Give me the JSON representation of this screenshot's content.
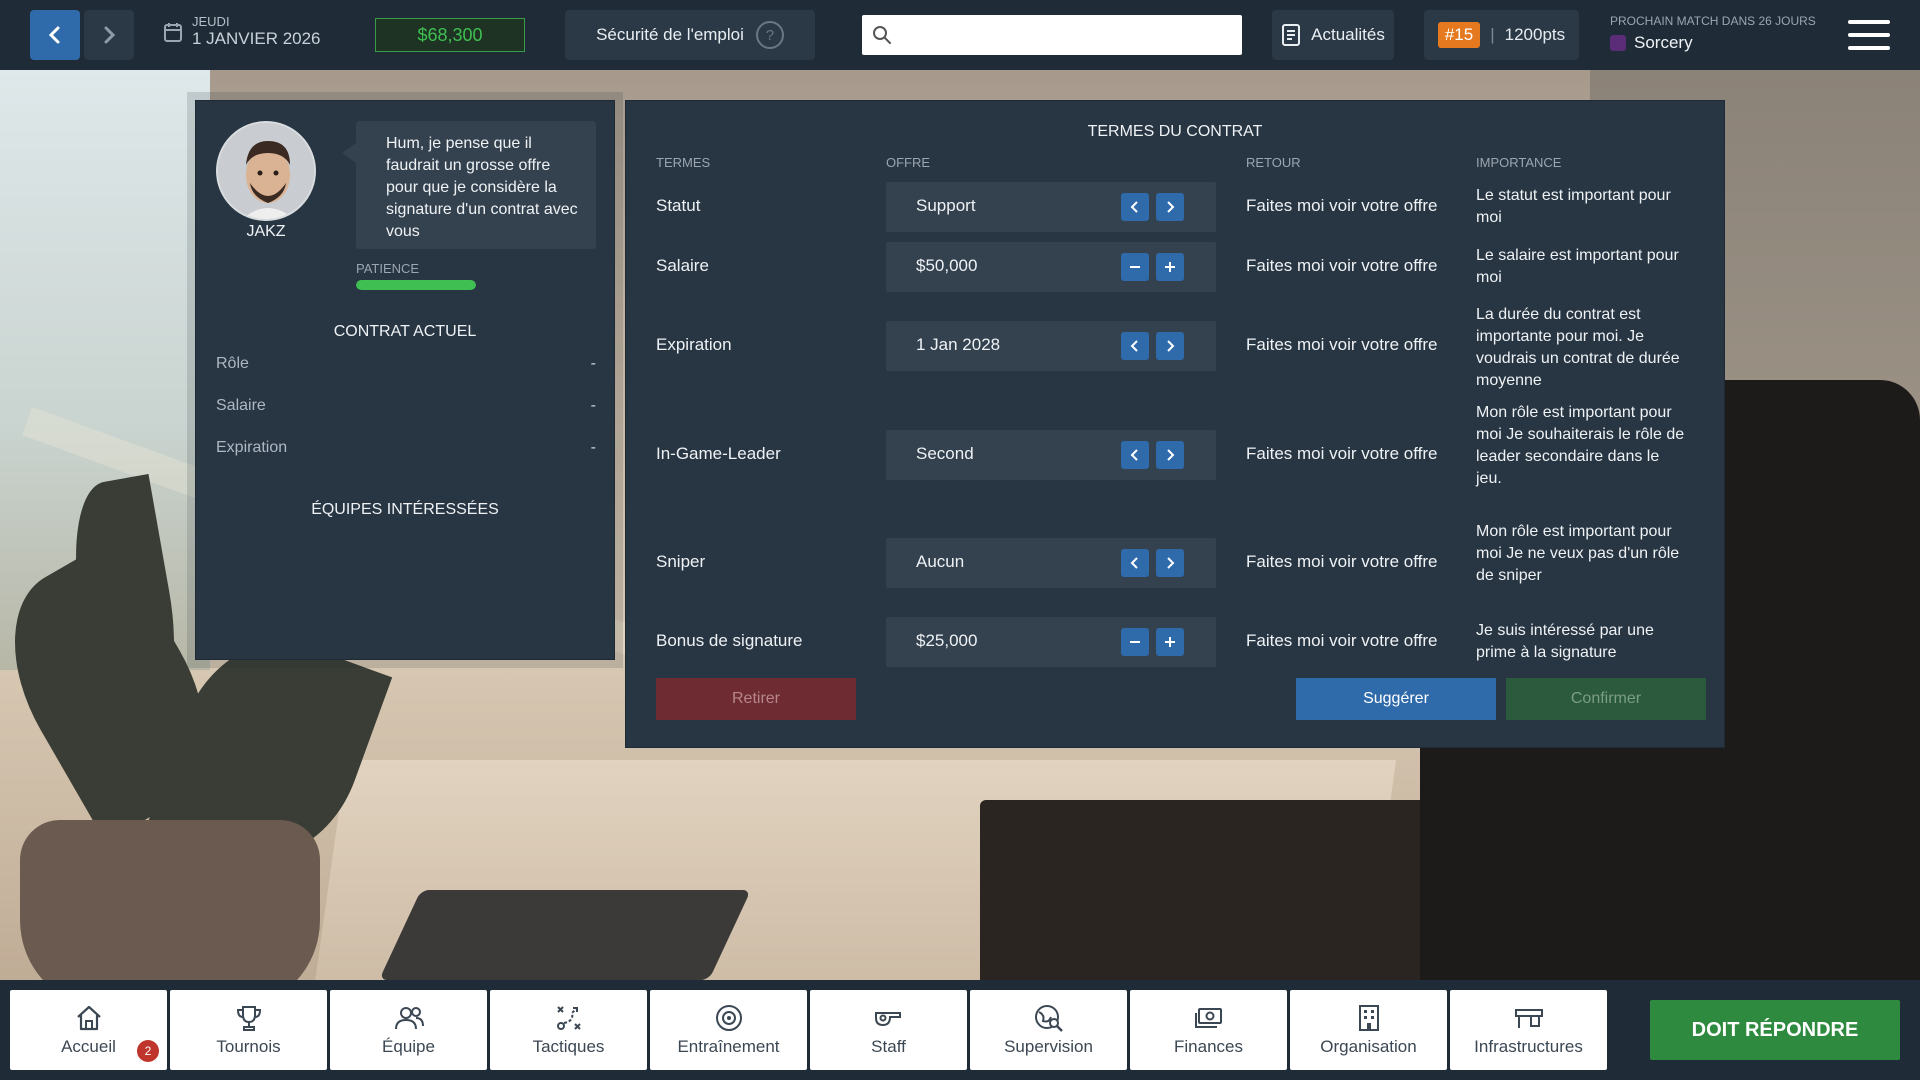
{
  "topbar": {
    "day": "JEUDI",
    "date": "1 JANVIER 2026",
    "money": "$68,300",
    "security_label": "Sécurité de l'emploi",
    "security_help": "?",
    "search_placeholder": "",
    "news_label": "Actualités",
    "rank_badge": "#15",
    "rank_sep": "|",
    "rank_points": "1200pts",
    "next_match_label": "PROCHAIN MATCH DANS 26 JOURS",
    "next_match_team": "Sorcery"
  },
  "player": {
    "name": "JAKZ",
    "speech": "Hum, je pense que il faudrait un grosse offre pour que je considère la signature d'un contrat avec vous",
    "patience_label": "PATIENCE",
    "patience_level": 1.0
  },
  "current_contract": {
    "title": "CONTRAT ACTUEL",
    "rows": [
      {
        "label": "Rôle",
        "value": "-"
      },
      {
        "label": "Salaire",
        "value": "-"
      },
      {
        "label": "Expiration",
        "value": "-"
      }
    ],
    "interested_title": "ÉQUIPES INTÉRESSÉES"
  },
  "contract_terms": {
    "title": "TERMES DU CONTRAT",
    "headers": {
      "terms": "TERMES",
      "offer": "OFFRE",
      "return": "RETOUR",
      "importance": "IMPORTANCE"
    },
    "rows": [
      {
        "term": "Statut",
        "offer": "Support",
        "control": "arrows",
        "return": "Faites moi voir votre offre",
        "importance": "Le statut est important pour moi"
      },
      {
        "term": "Salaire",
        "offer": "$50,000",
        "control": "plusminus",
        "return": "Faites moi voir votre offre",
        "importance": "Le salaire est important pour moi"
      },
      {
        "term": "Expiration",
        "offer": "1 Jan 2028",
        "control": "arrows",
        "return": "Faites moi voir votre offre",
        "importance": "La durée du contrat est importante pour moi. Je voudrais un contrat de durée moyenne"
      },
      {
        "term": "In-Game-Leader",
        "offer": "Second",
        "control": "arrows",
        "return": "Faites moi voir votre offre",
        "importance": "Mon rôle est important pour moi Je souhaiterais le rôle de leader secondaire dans le jeu."
      },
      {
        "term": "Sniper",
        "offer": "Aucun",
        "control": "arrows",
        "return": "Faites moi voir votre offre",
        "importance": "Mon rôle est important pour moi Je ne veux pas d'un rôle de sniper"
      },
      {
        "term": "Bonus de signature",
        "offer": "$25,000",
        "control": "plusminus",
        "return": "Faites moi voir votre offre",
        "importance": "Je suis intéressé par une prime à la signature"
      }
    ],
    "buttons": {
      "withdraw": "Retirer",
      "suggest": "Suggérer",
      "confirm": "Confirmer"
    }
  },
  "bottom_nav": {
    "tabs": [
      {
        "label": "Accueil",
        "icon": "home-icon"
      },
      {
        "label": "Tournois",
        "icon": "trophy-icon"
      },
      {
        "label": "Équipe",
        "icon": "team-icon"
      },
      {
        "label": "Tactiques",
        "icon": "tactics-icon"
      },
      {
        "label": "Entraînement",
        "icon": "target-icon"
      },
      {
        "label": "Staff",
        "icon": "whistle-icon"
      },
      {
        "label": "Supervision",
        "icon": "globe-search-icon"
      },
      {
        "label": "Finances",
        "icon": "money-icon"
      },
      {
        "label": "Organisation",
        "icon": "building-icon"
      },
      {
        "label": "Infrastructures",
        "icon": "infrastructure-icon"
      }
    ],
    "notification_count": "2",
    "respond_label": "DOIT RÉPONDRE"
  },
  "colors": {
    "accent_blue": "#2f6bab",
    "money_green": "#3fbf52",
    "rank_orange": "#e4791f",
    "respond_green": "#2d8a3e",
    "withdraw_red": "#6e2c32"
  }
}
